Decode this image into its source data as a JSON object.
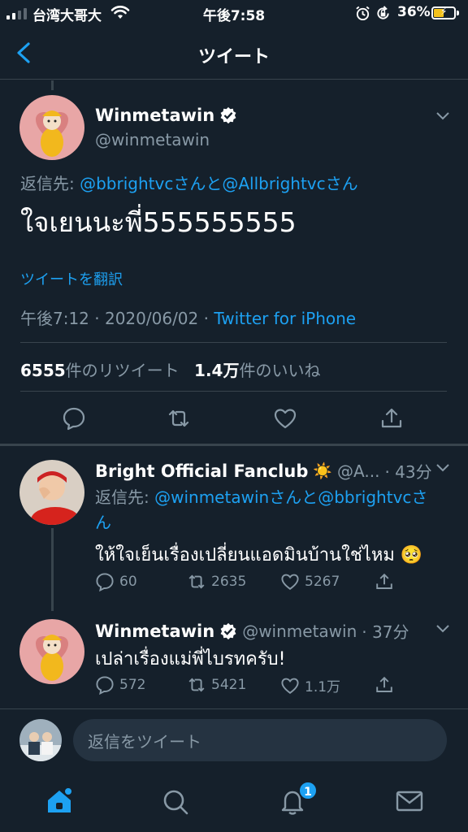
{
  "status_bar": {
    "carrier": "台湾大哥大",
    "time": "午後7:58",
    "battery_percent": "36%",
    "battery_level": 0.36
  },
  "nav": {
    "title": "ツイート"
  },
  "main_tweet": {
    "name": "Winmetawin",
    "handle": "@winmetawin",
    "reply_prefix": "返信先: ",
    "reply_to_1": "@bbrightvc",
    "reply_sep_1": "さんと",
    "reply_to_2": "@Allbrightvc",
    "reply_sep_2": "さん",
    "text": "ใจเยนนะพี่555555555",
    "translate": "ツイートを翻訳",
    "timestamp": "午後7:12 · 2020/06/02 · ",
    "source": "Twitter for iPhone",
    "retweet_count": "6555",
    "retweet_label": "件のリツイート",
    "like_count": "1.4万",
    "like_label": "件のいいね"
  },
  "reply_1": {
    "name": "Bright Official Fanclub",
    "emoji": "☀️",
    "handle": "@A...",
    "time": "· 43分",
    "reply_prefix": "返信先: ",
    "reply_to_1": "@winmetawin",
    "reply_sep_1": "さんと",
    "reply_to_2": "@bbrightvc",
    "reply_sep_2a": "さ",
    "reply_sep_2b": "ん",
    "text": "ให้ใจเย็นเรื่องเปลี่ยนแอดมินบ้านใช่ไหม 🥺",
    "replies": "60",
    "retweets": "2635",
    "likes": "5267"
  },
  "reply_2": {
    "name": "Winmetawin",
    "handle": "@winmetawin",
    "time": "· 37分",
    "text": "เปล่าเรื่องแม่พี่ไบรทครับ!",
    "replies": "572",
    "retweets": "5421",
    "likes": "1.1万"
  },
  "reply_bar": {
    "placeholder": "返信をツイート"
  },
  "tabbar": {
    "notification_badge": "1"
  },
  "colors": {
    "background": "#15202b",
    "accent": "#1da1f2",
    "muted": "#8899a6",
    "border": "#38444d"
  }
}
